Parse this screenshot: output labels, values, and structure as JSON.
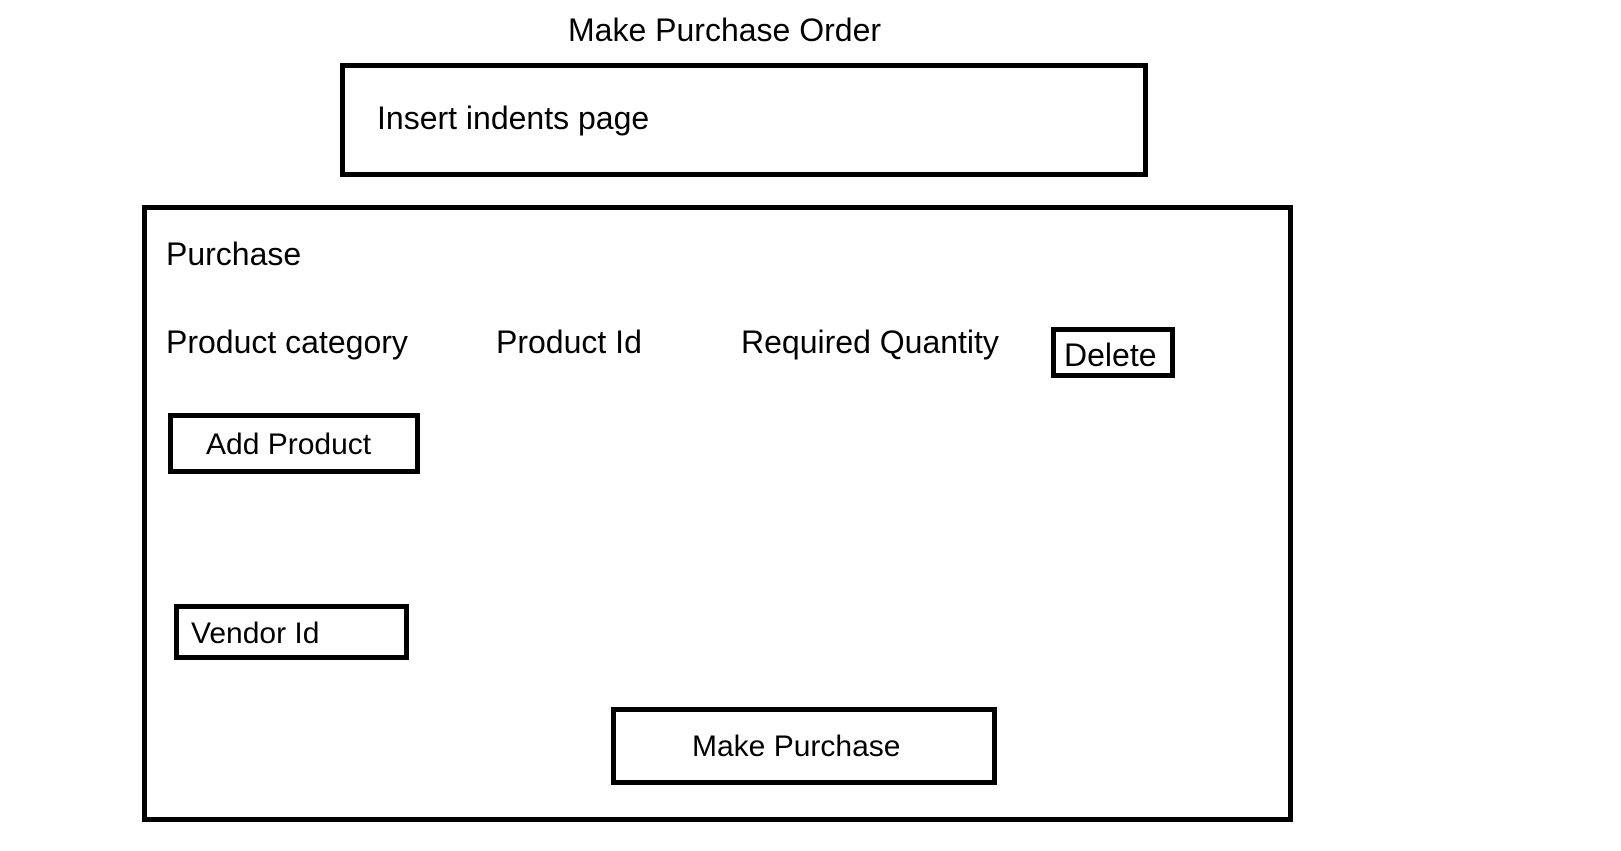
{
  "page": {
    "title": "Make Purchase Order"
  },
  "indents": {
    "label": "Insert indents page"
  },
  "purchase": {
    "heading": "Purchase",
    "columns": {
      "product_category": "Product category",
      "product_id": "Product Id",
      "required_quantity": "Required Quantity"
    },
    "delete_label": "Delete",
    "add_product_label": "Add Product",
    "vendor_id_label": "Vendor Id",
    "make_purchase_label": "Make Purchase"
  }
}
